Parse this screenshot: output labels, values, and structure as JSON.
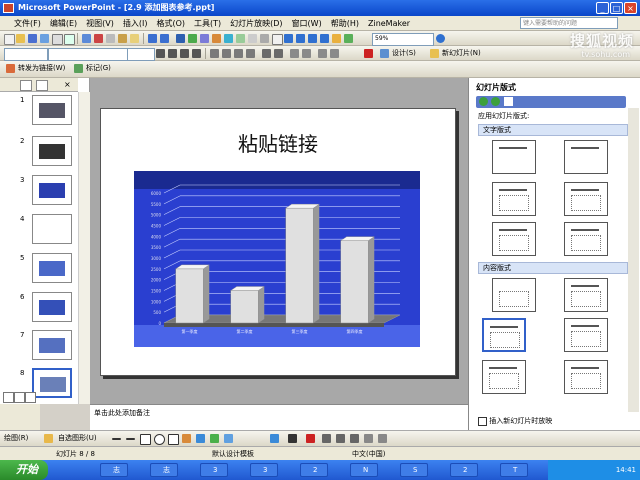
{
  "window": {
    "title": "Microsoft PowerPoint - [2.9 添加图表参考.ppt]"
  },
  "menu": [
    "文件(F)",
    "编辑(E)",
    "视图(V)",
    "插入(I)",
    "格式(O)",
    "工具(T)",
    "幻灯片放映(D)",
    "窗口(W)",
    "帮助(H)",
    "ZineMaker"
  ],
  "help_box": {
    "placeholder": "键入需要帮助的问题"
  },
  "toolbar": {
    "zoom": "59%",
    "design_label": "设计(S)",
    "new_slide_label": "新幻灯片(N)"
  },
  "toolbar3": {
    "repeat_label": "转发为链接(W)",
    "review_label": "标记(G)"
  },
  "watermark": {
    "main": "搜狐视频",
    "sub": "tv.sohu.com"
  },
  "slides": [
    {
      "num": "1"
    },
    {
      "num": "2"
    },
    {
      "num": "3"
    },
    {
      "num": "4"
    },
    {
      "num": "5"
    },
    {
      "num": "6"
    },
    {
      "num": "7"
    },
    {
      "num": "8"
    }
  ],
  "slide": {
    "title": "粘贴链接"
  },
  "notes": {
    "placeholder": "单击此处添加备注"
  },
  "chart_data": {
    "type": "bar",
    "categories": [
      "第一季度",
      "第二季度",
      "第三季度",
      "第四季度"
    ],
    "values": [
      2500,
      1500,
      5300,
      3800
    ],
    "title": "",
    "xlabel": "",
    "ylabel": "",
    "ylim": [
      0,
      6000
    ],
    "yticks": [
      "0",
      "500",
      "1000",
      "1500",
      "2000",
      "2500",
      "3000",
      "3500",
      "4000",
      "4500",
      "5000",
      "5500",
      "6000"
    ],
    "bar_color": "#e0e0e0",
    "background": "#2a3fd0"
  },
  "taskpane": {
    "title": "幻灯片版式",
    "apply_label": "应用幻灯片版式:",
    "section_text": "文字版式",
    "section_content": "内容版式",
    "insert_checkbox": "插入新幻灯片时放映"
  },
  "drawbar": {
    "draw_label": "绘图(R)",
    "autoshape_label": "自选图形(U)"
  },
  "status": {
    "slide": "幻灯片 8 / 8",
    "design": "默认设计模板",
    "lang": "中文(中国)"
  },
  "taskbar": {
    "start": "开始",
    "items": [
      "志",
      "志",
      "3",
      "3",
      "2",
      "N",
      "S",
      "2",
      "T"
    ],
    "time": "14:41"
  }
}
